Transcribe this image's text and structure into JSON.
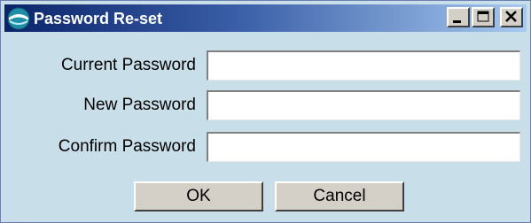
{
  "window": {
    "title": "Password Re-set"
  },
  "titlebar_buttons": {
    "minimize_icon": "minimize-icon",
    "maximize_icon": "maximize-icon",
    "close_icon": "close-icon"
  },
  "form": {
    "fields": [
      {
        "label": "Current Password",
        "value": ""
      },
      {
        "label": "New Password",
        "value": ""
      },
      {
        "label": "Confirm Password",
        "value": ""
      }
    ]
  },
  "buttons": {
    "ok_label": "OK",
    "cancel_label": "Cancel"
  },
  "colors": {
    "dialog_background": "#c8dfea",
    "titlebar_start": "#0a246a",
    "titlebar_end": "#a6caf0",
    "button_face": "#d4d0c8"
  }
}
